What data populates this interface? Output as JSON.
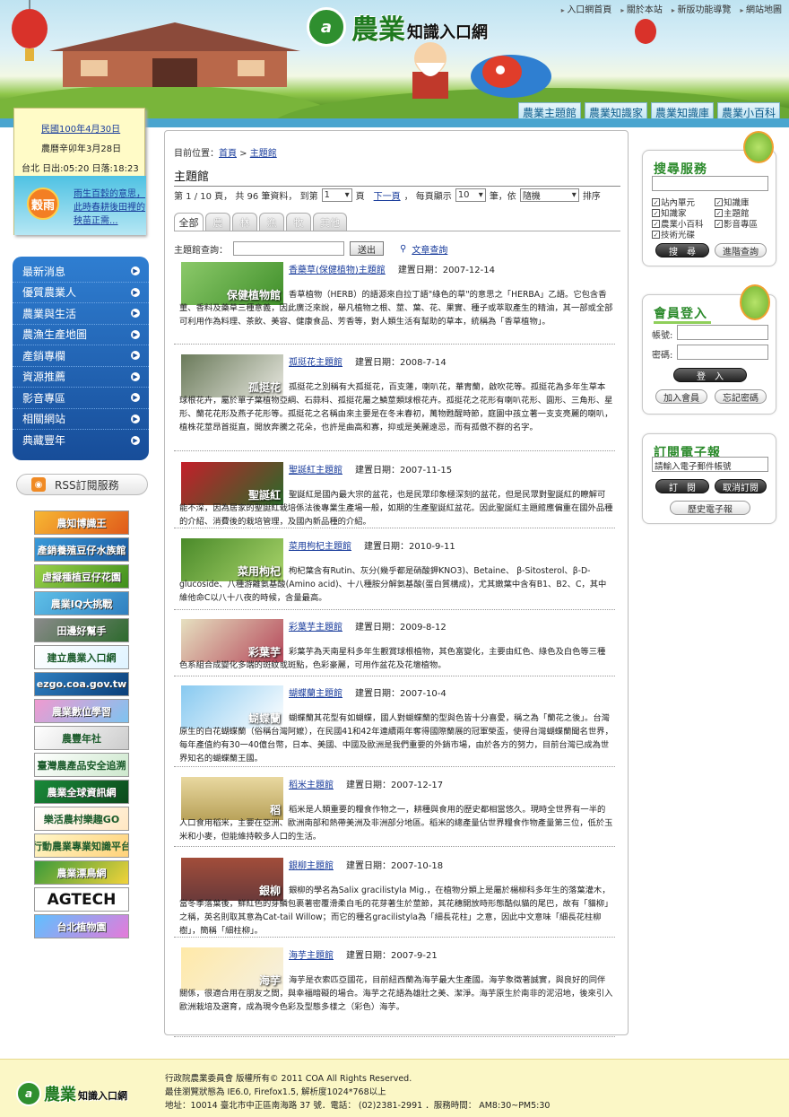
{
  "header": {
    "topnav": [
      "入口網首頁",
      "關於本站",
      "新版功能導覽",
      "網站地圖"
    ],
    "logo_big": "農業",
    "logo_small": "知識入口網",
    "mainnav": [
      "農業主題館",
      "農業知識家",
      "農業知識庫",
      "農業小百科"
    ]
  },
  "note": {
    "date": "民國100年4月30日",
    "lunar": "農曆辛卯年3月28日",
    "sun": "台北 日出:05:20 日落:18:23",
    "badge": "穀雨",
    "weather": "雨生百穀的意思，此時春耕後田裡的秧苗正需..."
  },
  "leftmenu": [
    "最新消息",
    "優質農業人",
    "農業與生活",
    "農漁生產地圖",
    "產銷專欄",
    "資源推薦",
    "影音專區",
    "相關網站",
    "典藏豐年"
  ],
  "rss": "RSS訂閱服務",
  "banners": [
    "農知博識王",
    "產銷養殖豆仔水族館",
    "虛擬種植豆仔花園",
    "農業IQ大挑戰",
    "田邊好幫手",
    "建立農業入口網",
    "ezgo.coa.gov.tw",
    "農業數位學習",
    "農豐年社",
    "臺灣農產品安全追溯",
    "農業全球資訊網",
    "樂活農村樂趣GO",
    "行動農業專業知識平台",
    "農業漂鳥網",
    "AGTECH",
    "台北植物園"
  ],
  "content": {
    "crumb_label": "目前位置：",
    "crumb_home": "首頁",
    "crumb_sep": " > ",
    "crumb_current": "主題館",
    "title": "主題館",
    "pager": {
      "p1": "第 1 / 10 頁， 共 96 筆資料， 到第",
      "page": "1",
      "p2": "頁",
      "next": "下一頁",
      "p3": "， 每頁顯示",
      "per": "10",
      "p4": "筆，依",
      "sort": "隨機",
      "p5": "排序"
    },
    "tabs": [
      "全部",
      "農",
      "林",
      "漁",
      "牧",
      "其他"
    ],
    "search_label": "主題館查詢：",
    "search_btn": "送出",
    "search_link": "文章查詢",
    "articles": [
      {
        "title": "香藥草(保健植物)主題館",
        "date": "建置日期：2007-12-14",
        "thumb": "保健植物館",
        "body": "香草植物（HERB）的語源來自拉丁語\"綠色的草\"的意思之「HERBA」乙語。它包含香菫、香料及藥草三種意義，因此廣泛來說，舉凡植物之根、莖、葉、花、果實、種子或萃取產生的精油，其一部或全部可利用作為料理、茶飲、美容、健康食品、芳香等，對人類生活有幫助的草本，統稱為「香草植物」。"
      },
      {
        "title": "孤挺花主題館",
        "date": "建置日期：2008-7-14",
        "thumb": "孤挺花",
        "body": "孤挺花之別稱有大孤挺花，百支蓮，喇叭花，華胄蘭，啟吹花等。孤挺花為多年生草本球根花卉，屬於單子葉植物亞綱、石蒜科、孤挺花屬之鱗莖類球根花卉。孤挺花之花形有喇叭花形、圓形、三角形、星形、蘭花花形及燕子花形等。孤挺花之名稱由來主要是在冬末春初，萬物甦醒時節，庭園中孩立著一支支亮麗的喇叭，植株花莖昂首挺直，開放奔騰之花朵，也許是曲高和寡，抑或是美麗遠忌，而有孤傲不群的名字。"
      },
      {
        "title": "聖誕紅主題館",
        "date": "建置日期：2007-11-15",
        "thumb": "聖誕紅",
        "body": "聖誕紅是國內最大宗的盆花，也是民眾印象極深刻的盆花，但是民眾對聖誕紅的瞭解可能不深，因為居家的聖誕紅栽培係法後專業生產場一般，如期的生產聖誕紅盆花。因此聖誕紅主題館應偏重在國外品種的介紹、消費後的栽培管理，及國內新品種的介紹。"
      },
      {
        "title": "菜用枸杞主題館",
        "date": "建置日期：2010-9-11",
        "thumb": "菜用枸杞",
        "body": "枸杞葉含有Rutin、灰分(幾乎都是硝酸鉀KNO3)、Betaine、 β-Sitosterol、β-D-glucoside、八種游離氨基酸(Amino acid)、十八種胺分解氨基酸(蛋白質構成)，尤其嫩葉中含有B1、B2、C，其中維他命C以八十八夜的時候，含量最高。"
      },
      {
        "title": "彩葉芋主題館",
        "date": "建置日期：2009-8-12",
        "thumb": "彩葉芋",
        "body": "彩葉芋為天南星科多年生觀賞球根植物，其色富變化，主要由紅色、綠色及白色等三種色系組合成變化多端的斑紋或斑點，色彩豪麗，可用作盆花及花壇植物。"
      },
      {
        "title": "蝴蝶蘭主題館",
        "date": "建置日期：2007-10-4",
        "thumb": "蝴蝶蘭",
        "body": "蝴蝶蘭其花型有如蝴蝶，國人對蝴蝶蘭的型與色皆十分喜愛，稱之為「蘭花之後」。台灣原生的白花蝴蝶蘭（俗稱台灣阿嬤），在民國41和42年連續兩年奪得國際蘭展的冠軍榮盃，使得台灣蝴蝶蘭聞名世界，每年產值約有30一40億台幣，日本、美國、中國及歐洲是我們重要的外銷市場，由於各方的努力，目前台灣已成為世界知名的蝴蝶蘭王國。"
      },
      {
        "title": "稻米主題館",
        "date": "建置日期：2007-12-17",
        "thumb": "稻",
        "body": "稻米是人類重要的糧食作物之一，耕種與食用的歷史都相當悠久。現時全世界有一半的人口食用稻米，主要在亞洲、歐洲南部和熱帶美洲及非洲部分地區。稻米的總產量佔世界糧食作物產量第三位，低於玉米和小麥，但能維持較多人口的生活。"
      },
      {
        "title": "銀柳主題館",
        "date": "建置日期：2007-10-18",
        "thumb": "銀柳",
        "body": "銀柳的學名為Salix gracilistyla Mig.，在植物分類上是屬於楊柳科多年生的落葉灌木，當冬季落葉後，鮮紅色的芽鱗包裹著密覆滑柔白毛的花芽著生於莖節，其花穗開放時形態酷似貓的尾巴，故有「貓柳」之稱，英名則取其意為Cat-tail Willow；而它的種名gracilistyla為「細長花柱」之意，因此中文意味「細長花柱柳樹」，簡稱「細柱柳」。"
      },
      {
        "title": "海芋主題館",
        "date": "建置日期：2007-9-21",
        "thumb": "海芋",
        "body": "海芋是衣索匹亞國花，目前紐西蘭為海芋最大生產國。海芋象徵著誠實，與良好的同伴關係，很適合用在朋友之間，與幸福暗礙的場合。海芋之花語為雄壯之美、潔淨。海芋原生於南非的泥沼地，後來引入歐洲栽培及選育，成為現今色彩及型態多樣之（彩色）海芋。"
      }
    ]
  },
  "right": {
    "search_title": "搜尋服務",
    "checks": [
      "站內單元",
      "知識庫",
      "知識家",
      "主題館",
      "農業小百科",
      "影音專區",
      "技術光碟"
    ],
    "search_btn": "搜　尋",
    "adv_btn": "進階查詢",
    "login_title": "會員登入",
    "account": "帳號:",
    "password": "密碼:",
    "login_btn": "登　入",
    "join_btn": "加入會員",
    "forgot_btn": "忘記密碼",
    "epaper_title": "訂閱電子報",
    "epaper_placeholder": "請輸入電子郵件帳號",
    "sub_btn": "訂　閱",
    "unsub_btn": "取消訂閱",
    "history_btn": "歷史電子報"
  },
  "footer": {
    "line1": "行政院農業委員會 版權所有© 2011 COA All Rights Reserved.",
    "line2": "最佳瀏覽狀態為 IE6.0, Firefox1.5, 解析度1024*768以上",
    "line3": "地址：10014 臺北市中正區南海路 37 號．電話： (02)2381-2991 ．服務時間： AM8:30~PM5:30"
  }
}
